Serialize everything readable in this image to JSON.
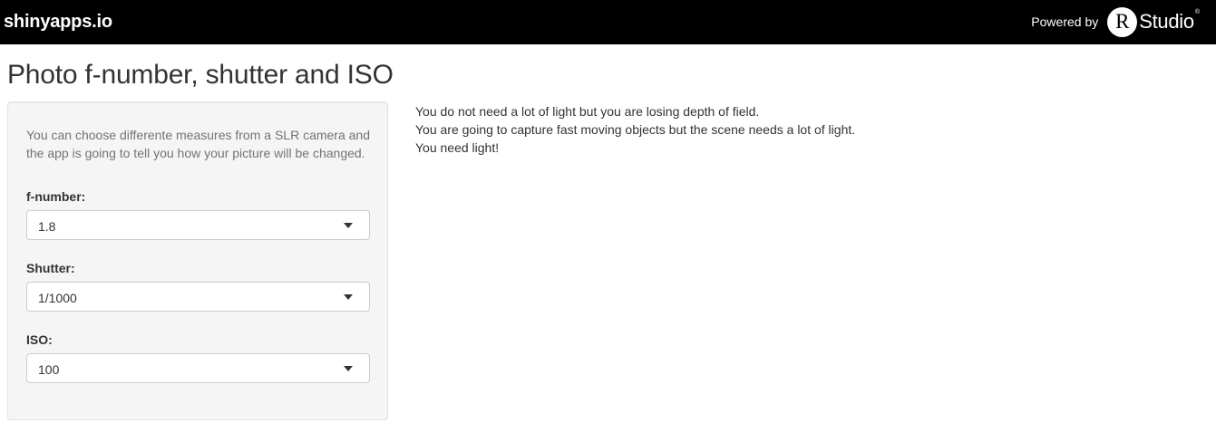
{
  "navbar": {
    "brand": "shinyapps.io",
    "powered_by": "Powered by",
    "rstudio_r": "R",
    "rstudio_name": "Studio",
    "rstudio_reg": "®"
  },
  "page": {
    "title": "Photo f-number, shutter and ISO"
  },
  "sidebar": {
    "help_text": "You can choose differente measures from a SLR camera and the app is going to tell you how your picture will be changed.",
    "fnumber": {
      "label": "f-number:",
      "value": "1.8"
    },
    "shutter": {
      "label": "Shutter:",
      "value": "1/1000"
    },
    "iso": {
      "label": "ISO:",
      "value": "100"
    }
  },
  "output": {
    "lines": [
      "You do not need a lot of light but you are losing depth of field.",
      "You are going to capture fast moving objects but the scene needs a lot of light.",
      "You need light!"
    ]
  },
  "colors": {
    "navbar_bg": "#000000",
    "well_bg": "#f5f5f5",
    "help_text": "#737373"
  }
}
